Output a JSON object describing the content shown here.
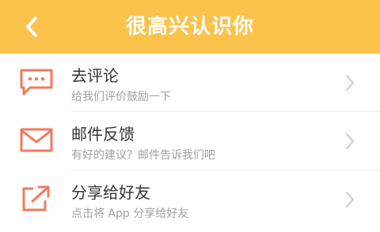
{
  "header": {
    "title": "很高兴认识你",
    "background": "#fbc34c"
  },
  "items": [
    {
      "title": "去评论",
      "subtitle": "给我们评价鼓励一下",
      "icon": "chat-bubble-icon"
    },
    {
      "title": "邮件反馈",
      "subtitle": "有好的建议？邮件告诉我们吧",
      "icon": "envelope-icon"
    },
    {
      "title": "分享给好友",
      "subtitle": "点击将 App 分享给好友",
      "icon": "share-icon"
    }
  ],
  "colors": {
    "accent": "#fbc34c",
    "icon": "#f07a5c",
    "title_text": "#333333",
    "subtitle_text": "#a0a0a0"
  }
}
